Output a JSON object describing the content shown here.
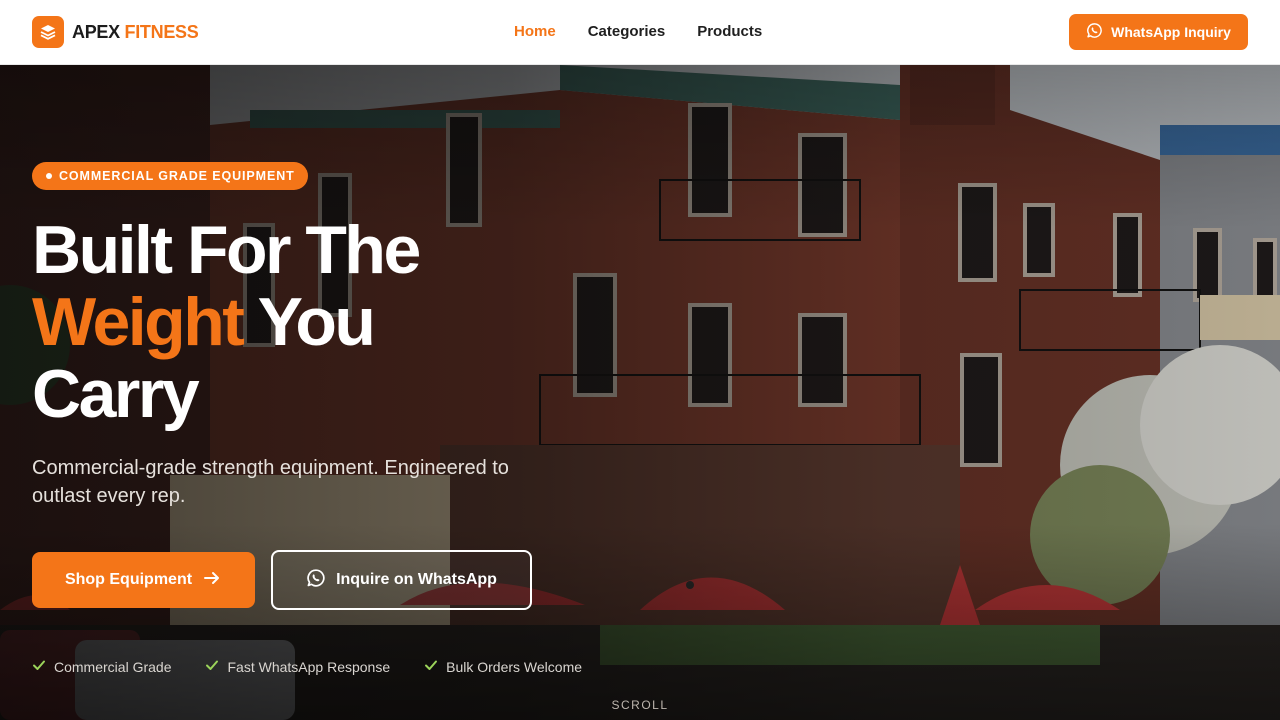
{
  "brand": {
    "name_part1": "APEX",
    "name_part2": "FITNESS",
    "logo_icon": "layers-icon",
    "accent_color": "#f47518"
  },
  "nav": {
    "links": [
      {
        "label": "Home",
        "active": true
      },
      {
        "label": "Categories",
        "active": false
      },
      {
        "label": "Products",
        "active": false
      }
    ],
    "cta_label": "WhatsApp Inquiry",
    "cta_icon": "whatsapp-icon"
  },
  "hero": {
    "badge": "COMMERCIAL GRADE EQUIPMENT",
    "headline": {
      "line1": "Built For The",
      "line2_accent": "Weight",
      "line2_rest": "You",
      "line3": "Carry"
    },
    "subcopy": "Commercial-grade strength equipment. Engineered to outlast every rep.",
    "primary_button": "Shop Equipment",
    "secondary_button": "Inquire on WhatsApp",
    "features": [
      "Commercial Grade",
      "Fast WhatsApp Response",
      "Bulk Orders Welcome"
    ],
    "scroll_label": "SCROLL"
  }
}
